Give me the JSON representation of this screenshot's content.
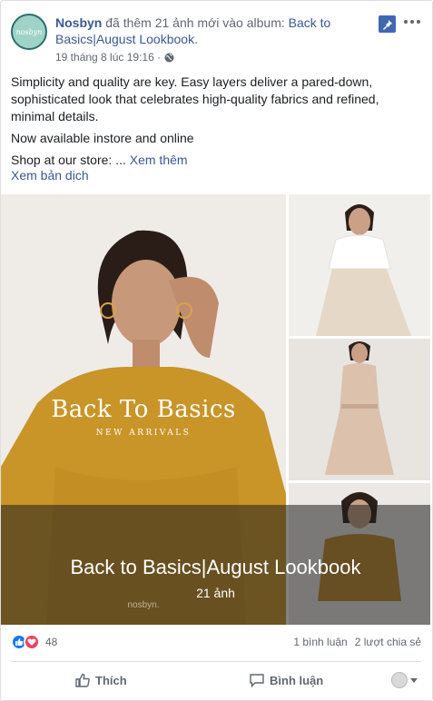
{
  "post": {
    "page_name": "Nosbyn",
    "action_text": " đã thêm 21 ảnh mới vào album: ",
    "album_name": "Back to Basics|August Lookbook.",
    "timestamp": "19 tháng 8 lúc 19:16 ·",
    "avatar_text": "nosbyn",
    "paragraphs": [
      "Simplicity and quality are key. Easy layers deliver a pared-down, sophisticated look that celebrates high-quality fabrics and refined, minimal details.",
      "Now available instore and online"
    ],
    "shop_text": "Shop at our store: ... ",
    "see_more": "Xem thêm",
    "translate": "Xem bản dịch"
  },
  "gallery": {
    "brand_title": "Back To Basics",
    "brand_subtitle": "NEW ARRIVALS",
    "watermark": "nosbyn.",
    "album_title": "Back to Basics|August Lookbook",
    "photo_count": "21 ảnh"
  },
  "stats": {
    "reaction_count": "48",
    "comments": "1 bình luận",
    "shares": "2 lượt chia sẻ"
  },
  "actions": {
    "like": "Thích",
    "comment": "Bình luận"
  },
  "colors": {
    "link": "#385898",
    "pin": "#4267b2",
    "mustard": "#c99528",
    "like": "#1877f2",
    "love": "#f33e58"
  }
}
